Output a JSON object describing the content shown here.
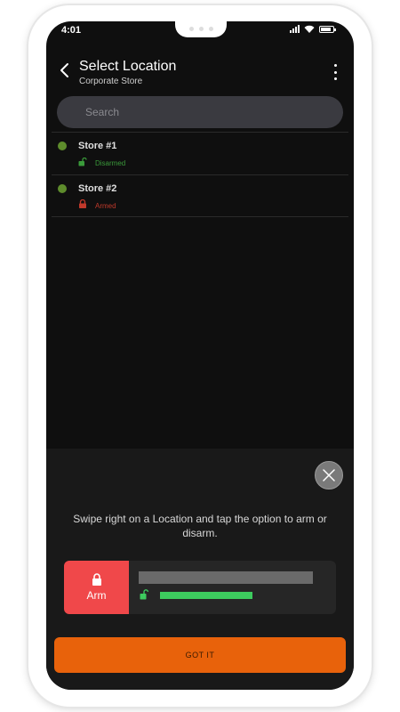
{
  "status_bar": {
    "time": "4:01"
  },
  "header": {
    "title": "Select Location",
    "subtitle": "Corporate Store"
  },
  "search": {
    "placeholder": "Search"
  },
  "locations": [
    {
      "name": "Store #1",
      "state": "Disarmed",
      "state_color": "#3a9a3a",
      "dot_color": "#5e8c2c",
      "icon": "unlocked-icon"
    },
    {
      "name": "Store #2",
      "state": "Armed",
      "state_color": "#c0392b",
      "dot_color": "#5e8c2c",
      "icon": "locked-icon"
    }
  ],
  "tutorial": {
    "hint": "Swipe right on a Location and tap the option to arm or disarm.",
    "arm_label": "Arm",
    "button_label": "GOT IT"
  },
  "colors": {
    "accent": "#e8620b",
    "arm": "#f0484a",
    "progress_green": "#3dcb5e"
  }
}
